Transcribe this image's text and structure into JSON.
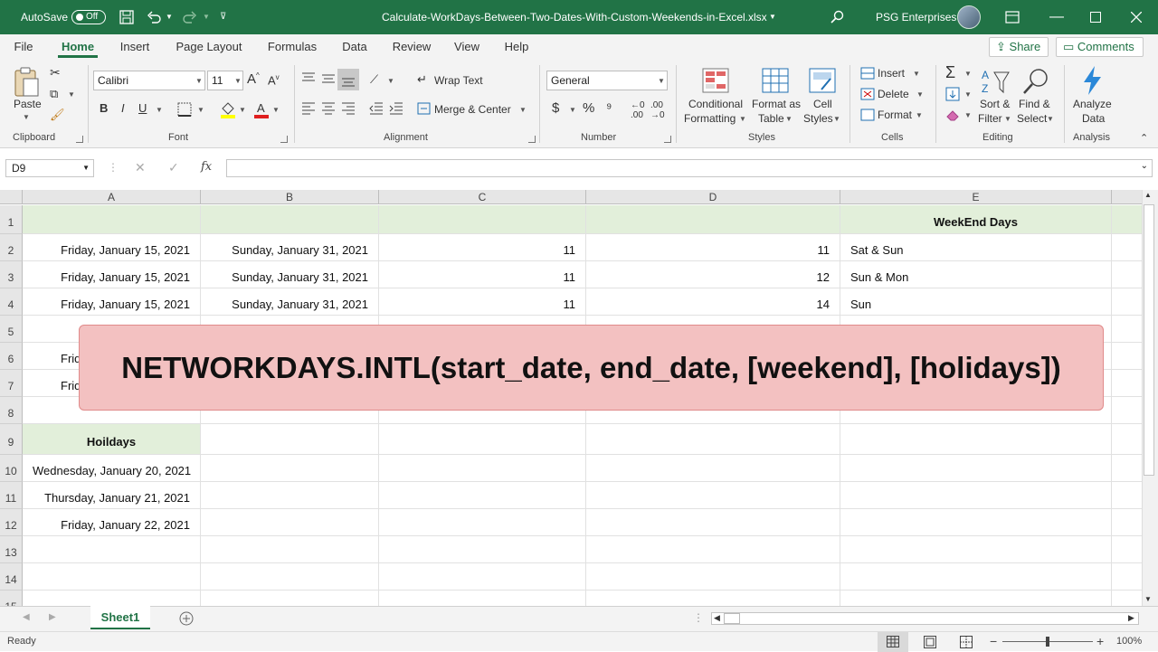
{
  "titlebar": {
    "autosave_label": "AutoSave",
    "autosave_state": "Off",
    "filename": "Calculate-WorkDays-Between-Two-Dates-With-Custom-Weekends-in-Excel.xlsx",
    "account": "PSG Enterprises"
  },
  "tabs": [
    "File",
    "Home",
    "Insert",
    "Page Layout",
    "Formulas",
    "Data",
    "Review",
    "View",
    "Help"
  ],
  "active_tab": "Home",
  "share_label": "Share",
  "comments_label": "Comments",
  "ribbon": {
    "clipboard": {
      "paste": "Paste",
      "label": "Clipboard"
    },
    "font": {
      "name": "Calibri",
      "size": "11",
      "bold": "B",
      "italic": "I",
      "underline": "U",
      "label": "Font"
    },
    "alignment": {
      "wrap": "Wrap Text",
      "merge": "Merge & Center",
      "label": "Alignment"
    },
    "number": {
      "format": "General",
      "label": "Number"
    },
    "styles": {
      "cond1": "Conditional",
      "cond2": "Formatting",
      "fat1": "Format as",
      "fat2": "Table",
      "cs1": "Cell",
      "cs2": "Styles",
      "label": "Styles"
    },
    "cells": {
      "insert": "Insert",
      "delete": "Delete",
      "format": "Format",
      "label": "Cells"
    },
    "editing": {
      "sort1": "Sort &",
      "sort2": "Filter",
      "find1": "Find &",
      "find2": "Select",
      "label": "Editing"
    },
    "analysis": {
      "a1": "Analyze",
      "a2": "Data",
      "label": "Analysis"
    }
  },
  "namebox": "D9",
  "columns": [
    "A",
    "B",
    "C",
    "D",
    "E"
  ],
  "rows": [
    {
      "n": "1",
      "cells": [
        "",
        "",
        "",
        "",
        "WeekEnd Days"
      ]
    },
    {
      "n": "2",
      "cells": [
        "Friday, January 15, 2021",
        "Sunday, January 31, 2021",
        "11",
        "11",
        "Sat & Sun"
      ]
    },
    {
      "n": "3",
      "cells": [
        "Friday, January 15, 2021",
        "Sunday, January 31, 2021",
        "11",
        "12",
        "Sun & Mon"
      ]
    },
    {
      "n": "4",
      "cells": [
        "Friday, January 15, 2021",
        "Sunday, January 31, 2021",
        "11",
        "14",
        "Sun"
      ]
    },
    {
      "n": "5",
      "cells": [
        "",
        "",
        "",
        "",
        ""
      ]
    },
    {
      "n": "6",
      "cells": [
        "Frid",
        "",
        "",
        "",
        ""
      ]
    },
    {
      "n": "7",
      "cells": [
        "Frid",
        "",
        "",
        "",
        ""
      ]
    },
    {
      "n": "8",
      "cells": [
        "",
        "",
        "",
        "",
        ""
      ]
    },
    {
      "n": "9",
      "cells": [
        "Hoildays",
        "",
        "",
        "",
        ""
      ]
    },
    {
      "n": "10",
      "cells": [
        "Wednesday, January 20, 2021",
        "",
        "",
        "",
        ""
      ]
    },
    {
      "n": "11",
      "cells": [
        "Thursday, January 21, 2021",
        "",
        "",
        "",
        ""
      ]
    },
    {
      "n": "12",
      "cells": [
        "Friday, January 22, 2021",
        "",
        "",
        "",
        ""
      ]
    },
    {
      "n": "13",
      "cells": [
        "",
        "",
        "",
        "",
        ""
      ]
    },
    {
      "n": "14",
      "cells": [
        "",
        "",
        "",
        "",
        ""
      ]
    },
    {
      "n": "15",
      "cells": [
        "",
        "",
        "",
        "",
        ""
      ]
    }
  ],
  "banner_text": "NETWORKDAYS.INTL(start_date, end_date, [weekend], [holidays])",
  "sheet_tab": "Sheet1",
  "status": {
    "ready": "Ready",
    "zoom": "100%"
  },
  "colors": {
    "accent": "#217346",
    "header_fill": "#e2efda",
    "banner_fill": "#f3c1c1"
  }
}
